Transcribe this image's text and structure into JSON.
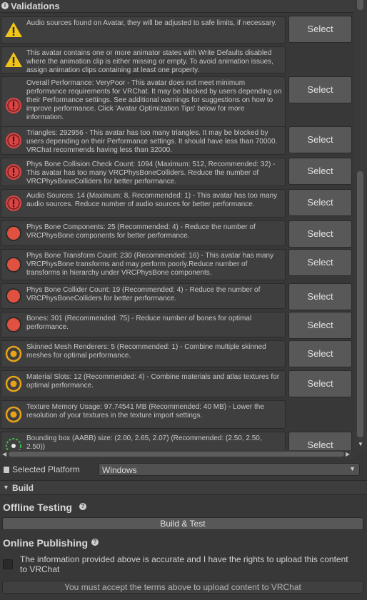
{
  "header": {
    "title": "Validations",
    "icon": "info-icon"
  },
  "select_label": "Select",
  "validations": [
    {
      "level": "warning",
      "message": "Audio sources found on Avatar, they will be adjusted to safe limits, if necessary.",
      "has_select": true
    },
    {
      "level": "warning",
      "message": "This avatar contains one or more animator states with Write Defaults disabled where the animation clip is either missing or empty. To avoid animation issues, assign animation clips containing at least one property.",
      "has_select": false
    },
    {
      "level": "error",
      "message": "Overall Performance: VeryPoor - This avatar does not meet minimum performance requirements for VRChat. It may be blocked by users depending on their Performance settings. See additional warnings for suggestions on how to improve performance. Click 'Avatar Optimization Tips' below for more information.",
      "has_select": true
    },
    {
      "level": "error",
      "message": "Triangles: 292956 - This avatar has too many triangles. It may be blocked by users depending on their Performance settings. It should have less than 70000. VRChat recommends having less than 32000.",
      "has_select": true
    },
    {
      "level": "error",
      "message": "Phys Bone Collision Check Count: 1094 (Maximum: 512, Recommended: 32) - This avatar has too many VRCPhysBoneColliders. Reduce the number of VRCPhysBoneColliders for better performance.",
      "has_select": true
    },
    {
      "level": "error",
      "message": "Audio Sources: 14 (Maximum: 8, Recommended: 1) - This avatar has too many audio sources. Reduce number of audio sources for better performance.",
      "has_select": true
    },
    {
      "level": "verypoor",
      "message": "Phys Bone Components: 25 (Recommended: 4) - Reduce the number of VRCPhysBone components for better performance.",
      "has_select": true
    },
    {
      "level": "verypoor",
      "message": "Phys Bone Transform Count: 230 (Recommended: 16) - This avatar has many VRCPhysBone transforms and may perform poorly.Reduce number of transforms in hierarchy under VRCPhysBone components.",
      "has_select": true
    },
    {
      "level": "verypoor",
      "message": "Phys Bone Collider Count: 19 (Recommended: 4) - Reduce the number of VRCPhysBoneColliders for better performance.",
      "has_select": true
    },
    {
      "level": "verypoor",
      "message": "Bones: 301 (Recommended: 75) - Reduce number of bones for optimal performance.",
      "has_select": true
    },
    {
      "level": "medium",
      "message": "Skinned Mesh Renderers: 5 (Recommended: 1) - Combine multiple skinned meshes for optimal performance.",
      "has_select": true
    },
    {
      "level": "medium",
      "message": "Material Slots: 12 (Recommended: 4) - Combine materials and atlas textures for optimal performance.",
      "has_select": true
    },
    {
      "level": "medium",
      "message": "Texture Memory Usage: 97.74541 MB (Recommended: 40 MB) - Lower the resolution of your textures in the texture import settings.",
      "has_select": false
    },
    {
      "level": "good",
      "message": "Bounding box (AABB) size: (2.00, 2.65, 2.07) (Recommended: (2.50, 2.50, 2.50))",
      "has_select": true
    }
  ],
  "platform": {
    "label": "Selected Platform",
    "value": "Windows"
  },
  "build": {
    "section_label": "Build",
    "offline_title": "Offline Testing",
    "build_test_label": "Build & Test",
    "online_title": "Online Publishing",
    "terms_text": "The information provided above is accurate and I have the rights to upload this content to VRChat",
    "upload_label": "You must accept the terms above to upload content to VRChat",
    "terms_checked": false
  },
  "colors": {
    "warning": "#f0c419",
    "error": "#d94545",
    "verypoor": "#e0523f",
    "medium": "#e8a317",
    "good": "#3fb950"
  }
}
